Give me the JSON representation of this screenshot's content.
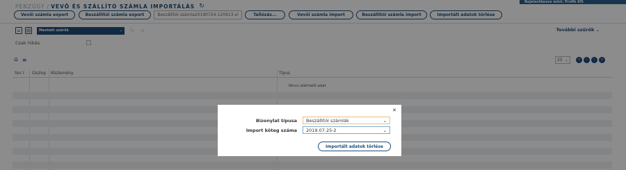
{
  "top_banner": "Bejelentkezve mint: Profik Kft.",
  "breadcrumb": {
    "section": "PÉNZÜGY",
    "separator": "/",
    "title": "VEVŐ ÉS SZÁLLÍTÓ SZÁMLA IMPORTÁLÁS",
    "refresh_icon": "refresh-icon"
  },
  "toolbar": {
    "customer_export": "Vevői számla export",
    "supplier_export": "Beszállítói számla export",
    "file_name": "Beszállítói számla20190724-120913.xl",
    "browse": "Tallózás...",
    "customer_import": "Vevői számla import",
    "supplier_import": "Beszállítói számla import",
    "delete_imported": "Importált adatok törlése"
  },
  "filters": {
    "saved_filter": "Mentett szűrők",
    "more_filters": "További szűrők",
    "only_valid": "Csak hibás"
  },
  "grid": {
    "page_size": "25",
    "columns": [
      "Sor",
      "Oszlop",
      "Közlemény",
      "Típus"
    ],
    "empty_text": "Nincs elérhető adat"
  },
  "modal": {
    "doc_type_label": "Bizonylat típusa",
    "doc_type_value": "Beszállítói számlák",
    "batch_label": "Import köteg száma",
    "batch_value": "2019.07.25-2",
    "delete_button": "Importált adatok törlése",
    "close_icon": "close-icon"
  },
  "colors": {
    "primary": "#1f4e79",
    "banner": "#2b5f8f",
    "overlay": "rgba(0,0,0,0.45)"
  }
}
